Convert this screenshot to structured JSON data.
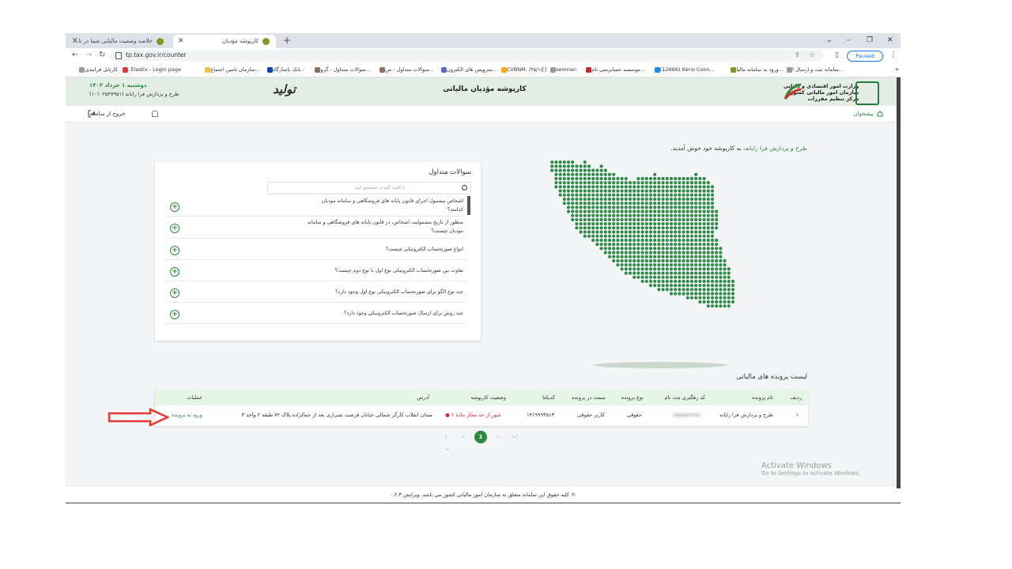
{
  "browser": {
    "tabs": [
      {
        "title": "خلاصه وضعیت مالیاتی شما در تا..."
      },
      {
        "title": "کارپوشه مؤدیان"
      }
    ],
    "new_tab": "+",
    "url": "tp.tax.gov.ir/counter",
    "paused": "Paused",
    "bookmarks": [
      "سامانه ثبت و ارسال ا...",
      "ورود به سامانه مالیا...",
      "(12686) Kerio Conn...",
      "موسسه حسابرسی نام...",
      "semnan",
      "CVBNM, /۲۵/۱\\[]",
      "سرویس های الکترون...",
      "سوالات متداول - س...",
      "سوالات متداول - گرو...",
      "بانک پاسارگاد :",
      "سازمان تامین اجتماع...",
      "Elastix - Login page",
      "کارتابل فرایندی"
    ]
  },
  "header": {
    "title": "کارپوشه مؤدیان مالیاتی",
    "date": "دوشنبه ۱ خرداد ۱۴۰۲",
    "company": "طرح و پردازش فرا رایانه (۱۰۱۰۲۵۴۷۹۵۱)",
    "slogan": "تولید",
    "org_name_line1": "وزارت امور اقتصادی و دارایی",
    "org_name_line2": "سازمان امور مالیاتی کشور",
    "org_name_line3": "مرکز تنظیم مقررات"
  },
  "menu": {
    "home": "پیشخوان",
    "logout": "خروج از سامانه"
  },
  "welcome": {
    "company": "طرح و پردازش فرا رایانه",
    "text": "، به کارپوشه خود خوش آمدید."
  },
  "faq": {
    "title": "سوالات متداول",
    "search_placeholder": "با کلمه کلیدی جستجو کنید",
    "items": [
      "اشخاص مشمول اجرای قانون پایانه های فروشگاهی و سامانه مودیان کدامند؟",
      "منظور از تاریخ مشمولیت اشخاص، در قانون پایانه های فروشگاهی و سامانه مودیان چیست؟",
      "انواع صورتحساب الکترونیکی چیست؟",
      "تفاوت بین صورتحساب الکترونیکی نوع اول با نوع دوم چیست؟",
      "چند نوع الگو برای صورتحساب الکترونیکی نوع اول وجود دارد؟",
      "چند روش برای ارسال صورتحساب الکترونیکی وجود دارد؟"
    ]
  },
  "files": {
    "title": "لیست پرونده های مالیاتی",
    "headers": {
      "row": "ردیف",
      "name": "نام پرونده",
      "tracking": "کد رهگیری ثبت نام",
      "type": "نوع پرونده",
      "role": "سمت در پرونده",
      "code": "کدیکتا",
      "status": "وضعیت کارپوشه",
      "address": "آدرس",
      "ops": "عملیات"
    },
    "rows": [
      {
        "row": "۱",
        "name": "طرح و پردازش فرا رایانه",
        "tracking": "۵۵۵۵۵۵۷۷۵۸",
        "type": "حقوقی",
        "role": "کاربر حقوقی",
        "code": "۱۴۱۹۹۹۳۵۱۳",
        "status": "عبور از حد مجاز ماده ۶",
        "address": "میدان انقلاب کارگر شمالی خیابان فرصت شیرازی بعد از جمالزاده پلاک ۷۲ طبقه ۲ واحد ۳",
        "action": "ورود به پرونده"
      }
    ]
  },
  "pager": {
    "current": "1"
  },
  "footer": "© کلیه حقوق این سامانه متعلق به سازمان امور مالیاتی کشور می باشد. ویرایش ۰.۲.۳",
  "activation": {
    "title": "Activate Windows",
    "subtitle": "Go to Settings to activate Windows."
  },
  "colors": {
    "accent": "#2a8a3a",
    "status_red": "#d32f2f",
    "arrow_red": "#e53935",
    "table_header": "#e6f6e6"
  }
}
